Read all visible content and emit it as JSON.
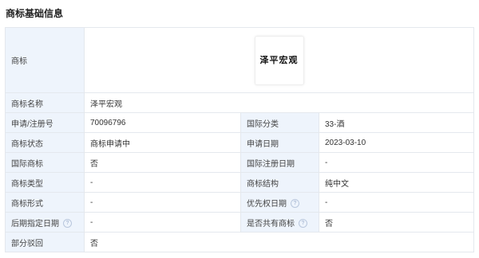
{
  "section_title": "商标基础信息",
  "help_glyph": "?",
  "logo": {
    "label": "商标",
    "image_text": "泽平宏观"
  },
  "name_row": {
    "label": "商标名称",
    "value": "泽平宏观"
  },
  "rows": [
    {
      "l1": "申请/注册号",
      "v1": "70096796",
      "l2": "国际分类",
      "v2": "33-酒"
    },
    {
      "l1": "商标状态",
      "v1": "商标申请中",
      "l2": "申请日期",
      "v2": "2023-03-10"
    },
    {
      "l1": "国际商标",
      "v1": "否",
      "l2": "国际注册日期",
      "v2": "-"
    },
    {
      "l1": "商标类型",
      "v1": "-",
      "l2": "商标结构",
      "v2": "纯中文"
    },
    {
      "l1": "商标形式",
      "v1": "-",
      "l2": "优先权日期",
      "v2": "-"
    },
    {
      "l1": "后期指定日期",
      "v1": "-",
      "l2": "是否共有商标",
      "v2": "否"
    }
  ],
  "last_row": {
    "label": "部分驳回",
    "value": "否"
  }
}
